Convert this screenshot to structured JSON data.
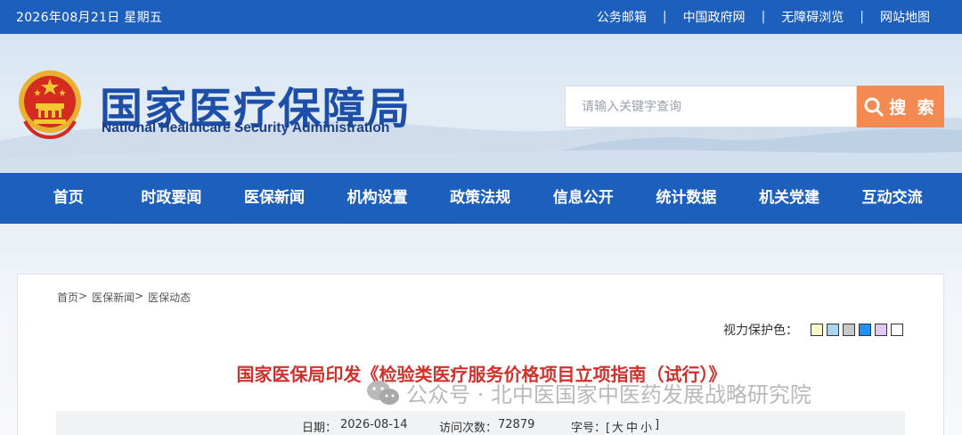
{
  "topbar": {
    "date": "2026年08月21日 星期五",
    "links": [
      "公务邮箱",
      "中国政府网",
      "无障碍浏览",
      "网站地图"
    ],
    "separator": "|"
  },
  "header": {
    "title_cn": "国家医疗保障局",
    "title_en": "National Healthcare Security Administration",
    "emblem_icon": "national-emblem-icon"
  },
  "search": {
    "placeholder": "请输入关键字查询",
    "button_label": "搜 索",
    "button_color": "#f28a52"
  },
  "nav": {
    "items": [
      "首页",
      "时政要闻",
      "医保新闻",
      "机构设置",
      "政策法规",
      "信息公开",
      "统计数据",
      "机关党建",
      "互动交流"
    ]
  },
  "breadcrumb": {
    "items": [
      "首页",
      "医保新闻",
      "医保动态"
    ],
    "arrow": ">"
  },
  "vision": {
    "label": "视力保护色：",
    "swatch_colors": [
      "#fafac8",
      "#a8d8f0",
      "#c8c8c8",
      "#1e90ff",
      "#e0c8f0",
      "#ffffff"
    ]
  },
  "article": {
    "title": "国家医保局印发《检验类医疗服务价格项目立项指南（试行）》",
    "date_label": "日期：",
    "date": "2026-08-14",
    "visits_label": "访问次数：",
    "visits": "72879",
    "fontsize_label": "字号：[",
    "font_large": "大",
    "font_medium": "中",
    "font_small": "小",
    "fontsize_close": "]"
  },
  "watermark": {
    "text": "公众号 · 北中医国家中医药发展战略研究院",
    "icon": "wechat-icon"
  },
  "colors": {
    "primary_blue": "#1c5fbd",
    "title_red": "#d0312d",
    "search_orange": "#f28a52"
  }
}
